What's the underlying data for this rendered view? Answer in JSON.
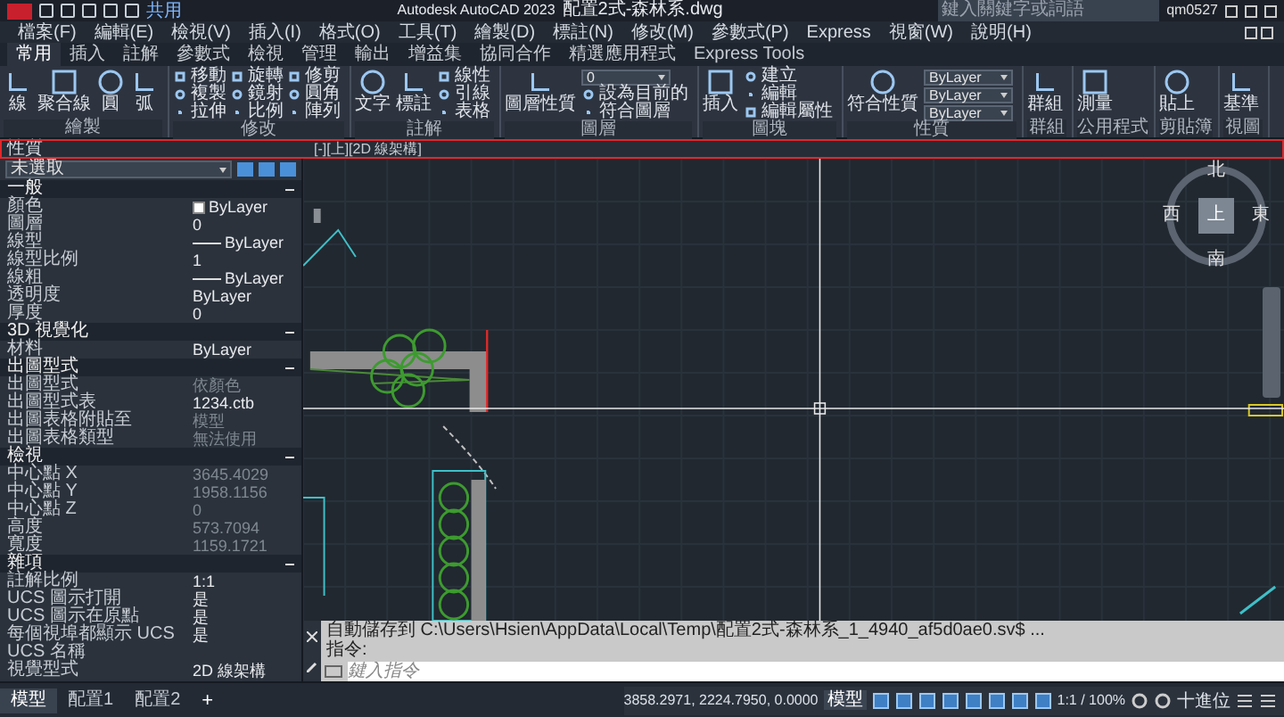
{
  "title_bar": {
    "share": "共用",
    "title": "Autodesk AutoCAD 2023",
    "file": "配置2式-森林系.dwg",
    "search": {
      "placeholder": "鍵入關鍵字或詞語"
    },
    "user": "qm0527"
  },
  "menu_bar": [
    "檔案(F)",
    "編輯(E)",
    "檢視(V)",
    "插入(I)",
    "格式(O)",
    "工具(T)",
    "繪製(D)",
    "標註(N)",
    "修改(M)",
    "參數式(P)",
    "Express",
    "視窗(W)",
    "說明(H)"
  ],
  "ribbon_tabs": [
    {
      "label": "常用",
      "selected": true
    },
    {
      "label": "插入",
      "selected": false
    },
    {
      "label": "註解",
      "selected": false
    },
    {
      "label": "參數式",
      "selected": false
    },
    {
      "label": "檢視",
      "selected": false
    },
    {
      "label": "管理",
      "selected": false
    },
    {
      "label": "輸出",
      "selected": false
    },
    {
      "label": "增益集",
      "selected": false
    },
    {
      "label": "協同合作",
      "selected": false
    },
    {
      "label": "精選應用程式",
      "selected": false
    },
    {
      "label": "Express Tools",
      "selected": false
    }
  ],
  "ribbon_panels": [
    {
      "label": "繪製",
      "items": [
        {
          "kind": "large",
          "label": "線"
        },
        {
          "kind": "large",
          "label": "聚合線"
        },
        {
          "kind": "large",
          "label": "圓"
        },
        {
          "kind": "large",
          "label": "弧"
        }
      ]
    },
    {
      "label": "修改",
      "items": [
        {
          "kind": "small",
          "label": "移動"
        },
        {
          "kind": "small",
          "label": "複製"
        },
        {
          "kind": "small",
          "label": "拉伸"
        },
        {
          "kind": "small",
          "label": "旋轉"
        },
        {
          "kind": "small",
          "label": "鏡射"
        },
        {
          "kind": "small",
          "label": "比例"
        },
        {
          "kind": "small",
          "label": "修剪"
        },
        {
          "kind": "small",
          "label": "圓角"
        },
        {
          "kind": "small",
          "label": "陣列"
        }
      ]
    },
    {
      "label": "註解",
      "items": [
        {
          "kind": "large",
          "label": "文字"
        },
        {
          "kind": "large",
          "label": "標註"
        },
        {
          "kind": "small",
          "label": "線性"
        },
        {
          "kind": "small",
          "label": "引線"
        },
        {
          "kind": "small",
          "label": "表格"
        }
      ]
    },
    {
      "label": "圖層",
      "items": [
        {
          "kind": "large",
          "label": "圖層性質"
        },
        {
          "kind": "dropdown",
          "label": "0"
        },
        {
          "kind": "small",
          "label": "設為目前的"
        },
        {
          "kind": "small",
          "label": "符合圖層"
        }
      ]
    },
    {
      "label": "圖塊",
      "items": [
        {
          "kind": "large",
          "label": "插入"
        },
        {
          "kind": "small",
          "label": "建立"
        },
        {
          "kind": "small",
          "label": "編輯"
        },
        {
          "kind": "small",
          "label": "編輯屬性"
        }
      ]
    },
    {
      "label": "性質",
      "items": [
        {
          "kind": "large",
          "label": "符合性質"
        },
        {
          "kind": "dropdown",
          "label": "ByLayer"
        },
        {
          "kind": "dropdown",
          "label": "ByLayer"
        },
        {
          "kind": "dropdown",
          "label": "ByLayer"
        }
      ]
    },
    {
      "label": "群組",
      "items": [
        {
          "kind": "large",
          "label": "群組"
        }
      ]
    },
    {
      "label": "公用程式",
      "items": [
        {
          "kind": "large",
          "label": "測量"
        }
      ]
    },
    {
      "label": "剪貼簿",
      "items": [
        {
          "kind": "large",
          "label": "貼上"
        }
      ]
    },
    {
      "label": "視圖",
      "items": [
        {
          "kind": "large",
          "label": "基準"
        }
      ]
    }
  ],
  "properties_panel": {
    "title": "性質",
    "selection": "未選取",
    "sections": [
      {
        "title": "一般",
        "expanded": true,
        "rows": [
          {
            "name": "顏色",
            "value": "ByLayer",
            "kind": "swatch",
            "disabled": false
          },
          {
            "name": "圖層",
            "value": "0",
            "kind": "text",
            "disabled": false
          },
          {
            "name": "線型",
            "value": "ByLayer",
            "kind": "line",
            "disabled": false
          },
          {
            "name": "線型比例",
            "value": "1",
            "kind": "text",
            "disabled": false
          },
          {
            "name": "線粗",
            "value": "ByLayer",
            "kind": "line",
            "disabled": false
          },
          {
            "name": "透明度",
            "value": "ByLayer",
            "kind": "text",
            "disabled": false
          },
          {
            "name": "厚度",
            "value": "0",
            "kind": "text",
            "disabled": false
          }
        ]
      },
      {
        "title": "3D 視覺化",
        "expanded": true,
        "rows": [
          {
            "name": "材料",
            "value": "ByLayer",
            "kind": "text",
            "disabled": false
          }
        ]
      },
      {
        "title": "出圖型式",
        "expanded": true,
        "rows": [
          {
            "name": "出圖型式",
            "value": "依顏色",
            "kind": "text",
            "disabled": true
          },
          {
            "name": "出圖型式表",
            "value": "1234.ctb",
            "kind": "text",
            "disabled": false
          },
          {
            "name": "出圖表格附貼至",
            "value": "模型",
            "kind": "text",
            "disabled": true
          },
          {
            "name": "出圖表格類型",
            "value": "無法使用",
            "kind": "text",
            "disabled": true
          }
        ]
      },
      {
        "title": "檢視",
        "expanded": true,
        "rows": [
          {
            "name": "中心點 X",
            "value": "3645.4029",
            "kind": "text",
            "disabled": true
          },
          {
            "name": "中心點 Y",
            "value": "1958.1156",
            "kind": "text",
            "disabled": true
          },
          {
            "name": "中心點 Z",
            "value": "0",
            "kind": "text",
            "disabled": true
          },
          {
            "name": "高度",
            "value": "573.7094",
            "kind": "text",
            "disabled": true
          },
          {
            "name": "寬度",
            "value": "1159.1721",
            "kind": "text",
            "disabled": true
          }
        ]
      },
      {
        "title": "雜項",
        "expanded": true,
        "rows": [
          {
            "name": "註解比例",
            "value": "1:1",
            "kind": "text",
            "disabled": false
          },
          {
            "name": "UCS 圖示打開",
            "value": "是",
            "kind": "text",
            "disabled": false
          },
          {
            "name": "UCS 圖示在原點",
            "value": "是",
            "kind": "text",
            "disabled": false
          },
          {
            "name": "每個視埠都顯示 UCS",
            "value": "是",
            "kind": "text",
            "disabled": false
          },
          {
            "name": "UCS 名稱",
            "kind": "text",
            "disabled": false
          },
          {
            "name": "視覺型式",
            "value": "2D 線架構",
            "kind": "text",
            "disabled": false
          }
        ]
      }
    ]
  },
  "viewport": {
    "label": "[-][上][2D 線架構]",
    "view_cube": {
      "north": "北",
      "west": "西",
      "top": "上",
      "east": "東",
      "south": "南"
    }
  },
  "command_line": {
    "history": [
      "自動儲存到 C:\\Users\\Hsien\\AppData\\Local\\Temp\\配置2式-森林系_1_4940_af5d0ae0.sv$ ...",
      "指令:"
    ],
    "placeholder": "鍵入指令"
  },
  "layout_tabs": [
    {
      "label": "模型",
      "selected": true
    },
    {
      "label": "配置1",
      "selected": false
    },
    {
      "label": "配置2",
      "selected": false
    }
  ],
  "add_tab": "+",
  "status_bar": {
    "coordinates": "3858.2971, 2224.7950, 0.0000",
    "model": "模型",
    "scale": "1:1 / 100%",
    "units": "十進位"
  }
}
